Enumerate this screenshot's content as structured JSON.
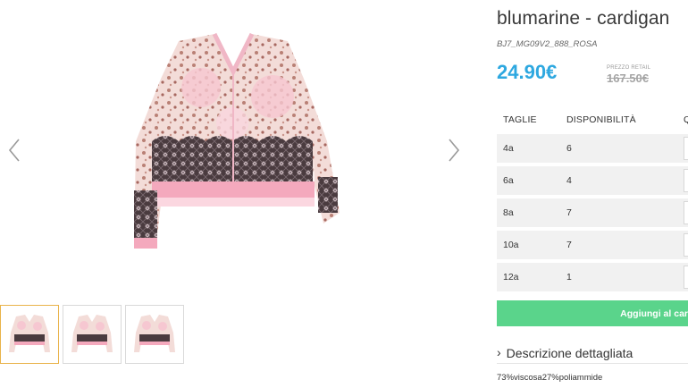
{
  "product": {
    "title": "blumarine - cardigan",
    "sku": "BJ7_MG09V2_888_ROSA",
    "price": "24.90€",
    "retail_label": "PREZZO RETAIL",
    "retail_price": "167.50€",
    "image_name": "pink-lace-cardigan"
  },
  "gallery": {
    "prev_icon": "chevron-left-icon",
    "next_icon": "chevron-right-icon",
    "thumbnail_count": 3,
    "active_thumbnail": 1
  },
  "sizes": {
    "headers": [
      "TAGLIE",
      "DISPONIBILITÀ",
      "Q"
    ],
    "rows": [
      {
        "size": "4a",
        "qty": "6"
      },
      {
        "size": "6a",
        "qty": "4"
      },
      {
        "size": "8a",
        "qty": "7"
      },
      {
        "size": "10a",
        "qty": "7"
      },
      {
        "size": "12a",
        "qty": "1"
      }
    ]
  },
  "cart": {
    "add_label": "Aggiungi al car"
  },
  "description": {
    "chevron": "›",
    "title": "Descrizione dettagliata",
    "composition": "73%viscosa27%poliammide"
  },
  "colors": {
    "price_blue": "#2ea8e0",
    "button_green": "#5ad48b",
    "active_thumb_border": "#e9b34a",
    "row_bg": "#f1f1f1"
  }
}
